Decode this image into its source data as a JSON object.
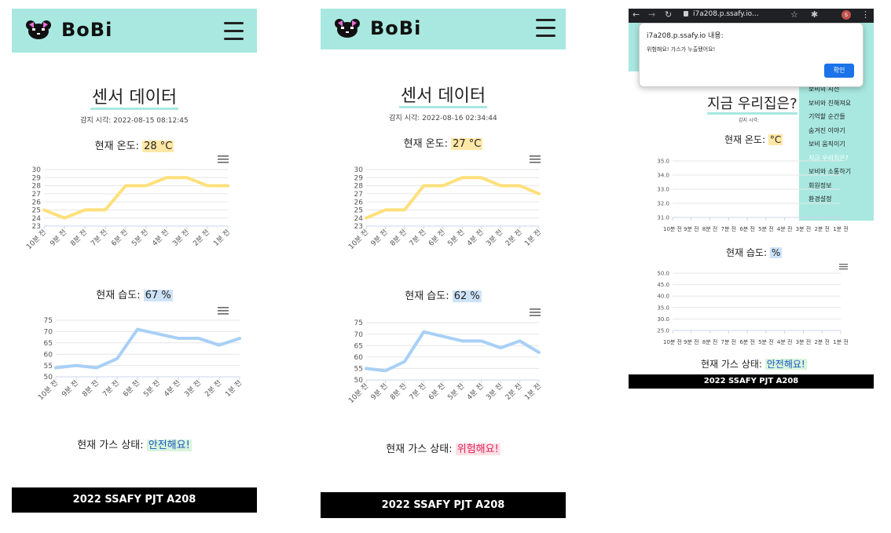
{
  "panels": [
    {
      "logo": "BoBi",
      "title": "센서 데이터",
      "detect_label": "감지 시각:",
      "detect_time": "2022-08-15 08:12:45",
      "temp_label": "현재 온도:",
      "temp_value": "28 °C",
      "humid_label": "현재 습도:",
      "humid_value": "67 %",
      "gas_label": "현재 가스 상태:",
      "gas_value": "안전해요!",
      "footer": "2022 SSAFY PJT A208"
    },
    {
      "logo": "BoBi",
      "title": "센서 데이터",
      "detect_label": "감지 시각:",
      "detect_time": "2022-08-16 02:34:44",
      "temp_label": "현재 온도:",
      "temp_value": "27 °C",
      "humid_label": "현재 습도:",
      "humid_value": "62 %",
      "gas_label": "현재 가스 상태:",
      "gas_value": "위험해요!",
      "footer": "2022 SSAFY PJT A208"
    },
    {
      "browser_url": "i7a208.p.ssafy.io...",
      "dialog_title": "i7a208.p.ssafy.io 내용:",
      "dialog_msg": "위험해요! 가스가 누출됐어요!",
      "dialog_btn": "확인",
      "title": "지금 우리집은?",
      "detect_label": "감지 시각:",
      "temp_label": "현재 온도:",
      "temp_value": "°C",
      "humid_label": "현재 습도:",
      "humid_value": "%",
      "gas_label": "현재 가스 상태:",
      "gas_value": "안전해요!",
      "footer": "2022 SSAFY PJT A208",
      "menu": [
        "보비의 시선",
        "보비와 친해져요",
        "기억할 순간들",
        "숨겨진 이야기",
        "보비 움직이기",
        "지금 우리집은?",
        "보비와 소통하기",
        "회원정보",
        "환경설정"
      ],
      "menu_active": 5
    }
  ],
  "chart_data": [
    {
      "type": "line",
      "title": "",
      "x": [
        "10분 전",
        "9분 전",
        "8분 전",
        "7분 전",
        "6분 전",
        "5분 전",
        "4분 전",
        "3분 전",
        "2분 전",
        "1분 전"
      ],
      "values": [
        25,
        24,
        25,
        25,
        28,
        28,
        29,
        29,
        28,
        28
      ],
      "yticks": [
        23,
        24,
        25,
        26,
        27,
        28,
        29,
        30
      ],
      "ylim": [
        23,
        30
      ],
      "color": "#ffe07a"
    },
    {
      "type": "line",
      "title": "",
      "x": [
        "10분 전",
        "9분 전",
        "8분 전",
        "7분 전",
        "6분 전",
        "5분 전",
        "4분 전",
        "3분 전",
        "2분 전",
        "1분 전"
      ],
      "values": [
        54,
        55,
        54,
        58,
        71,
        69,
        67,
        67,
        64,
        67
      ],
      "yticks": [
        50,
        55,
        60,
        65,
        70,
        75
      ],
      "ylim": [
        50,
        75
      ],
      "color": "#a8d0f6"
    },
    {
      "type": "line",
      "title": "",
      "x": [
        "10분 전",
        "9분 전",
        "8분 전",
        "7분 전",
        "6분 전",
        "5분 전",
        "4분 전",
        "3분 전",
        "2분 전",
        "1분 전"
      ],
      "values": [
        24,
        25,
        25,
        28,
        28,
        29,
        29,
        28,
        28,
        27
      ],
      "yticks": [
        23,
        24,
        25,
        26,
        27,
        28,
        29,
        30
      ],
      "ylim": [
        23,
        30
      ],
      "color": "#ffe07a"
    },
    {
      "type": "line",
      "title": "",
      "x": [
        "10분 전",
        "9분 전",
        "8분 전",
        "7분 전",
        "6분 전",
        "5분 전",
        "4분 전",
        "3분 전",
        "2분 전",
        "1분 전"
      ],
      "values": [
        55,
        54,
        58,
        71,
        69,
        67,
        67,
        64,
        67,
        62
      ],
      "yticks": [
        50,
        55,
        60,
        65,
        70,
        75
      ],
      "ylim": [
        50,
        75
      ],
      "color": "#a8d0f6"
    },
    {
      "type": "line",
      "title": "",
      "x": [
        "10분 전",
        "9분 전",
        "8분 전",
        "7분 전",
        "6분 전",
        "5분 전",
        "4분 전",
        "3분 전",
        "2분 전",
        "1분 전"
      ],
      "values": [],
      "yticks": [
        31.0,
        32.0,
        33.0,
        34.0,
        35.0
      ],
      "ylim": [
        31,
        35
      ],
      "color": "#ffe07a"
    },
    {
      "type": "line",
      "title": "",
      "x": [
        "10분 전",
        "9분 전",
        "8분 전",
        "7분 전",
        "6분 전",
        "5분 전",
        "4분 전",
        "3분 전",
        "2분 전",
        "1분 전"
      ],
      "values": [],
      "yticks": [
        25,
        30,
        35,
        40,
        45,
        50
      ],
      "ylim": [
        25,
        50
      ],
      "color": "#a8d0f6"
    }
  ],
  "icons": [
    "bear-logo-icon",
    "hamburger-menu-icon",
    "chart-menu-icon"
  ]
}
